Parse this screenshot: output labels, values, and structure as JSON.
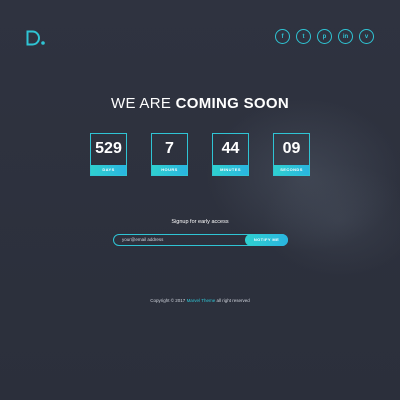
{
  "logo": {
    "letter": "D",
    "color": "#2fc4d4"
  },
  "social": [
    {
      "icon": "facebook-icon",
      "glyph": "f"
    },
    {
      "icon": "twitter-icon",
      "glyph": "t"
    },
    {
      "icon": "pinterest-icon",
      "glyph": "p"
    },
    {
      "icon": "linkedin-icon",
      "glyph": "in"
    },
    {
      "icon": "vimeo-icon",
      "glyph": "v"
    }
  ],
  "headline": {
    "light": "WE ARE",
    "bold": "COMING SOON"
  },
  "countdown": [
    {
      "value": "529",
      "label": "DAYS"
    },
    {
      "value": "7",
      "label": "HOURS"
    },
    {
      "value": "44",
      "label": "MINUTES"
    },
    {
      "value": "09",
      "label": "SECONDS"
    }
  ],
  "signup": {
    "title": "Signup for early access",
    "placeholder": "your@email address",
    "button_label": "NOTIFY ME"
  },
  "footer": {
    "prefix": "Copyright © 2017",
    "brand": "Marvel Theme",
    "suffix": "all right reserved"
  },
  "colors": {
    "accent": "#2fc4d4",
    "background": "#2d313d"
  }
}
